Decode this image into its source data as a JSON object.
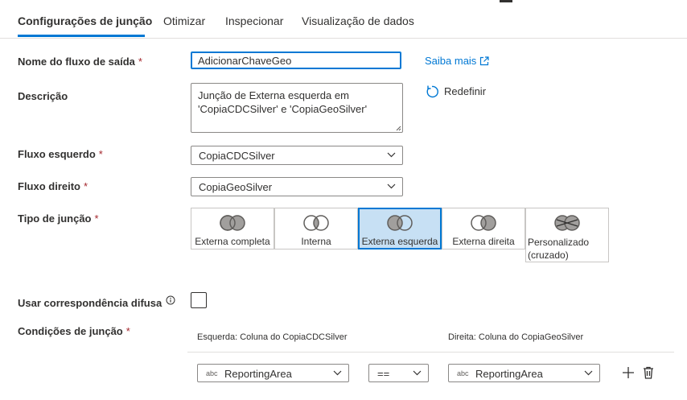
{
  "tabs": [
    {
      "label": "Configurações de junção",
      "active": true
    },
    {
      "label": "Otimizar",
      "active": false
    },
    {
      "label": "Inspecionar",
      "active": false
    },
    {
      "label": "Visualização de dados",
      "active": false
    }
  ],
  "form": {
    "output_stream": {
      "label": "Nome do fluxo de saída",
      "required": "*",
      "value": "AdicionarChaveGeo"
    },
    "description": {
      "label": "Descrição",
      "value": "Junção de Externa esquerda em 'CopiaCDCSilver' e 'CopiaGeoSilver'"
    },
    "left_stream": {
      "label": "Fluxo esquerdo",
      "required": "*",
      "value": "CopiaCDCSilver"
    },
    "right_stream": {
      "label": "Fluxo direito",
      "required": "*",
      "value": "CopiaGeoSilver"
    },
    "join_type": {
      "label": "Tipo de junção",
      "required": "*",
      "options": [
        {
          "label": "Externa completa",
          "icon": "venn-full-outer-icon",
          "selected": false
        },
        {
          "label": "Interna",
          "icon": "venn-inner-icon",
          "selected": false
        },
        {
          "label": "Externa esquerda",
          "icon": "venn-left-outer-icon",
          "selected": true
        },
        {
          "label": "Externa direita",
          "icon": "venn-right-outer-icon",
          "selected": false
        },
        {
          "label": "Personalizado (cruzado)",
          "icon": "venn-cross-icon",
          "selected": false
        }
      ]
    },
    "fuzzy": {
      "label": "Usar correspondência difusa",
      "checked": false
    },
    "conditions": {
      "label": "Condições de junção",
      "required": "*",
      "left_header": "Esquerda: Coluna do CopiaCDCSilver",
      "right_header": "Direita: Coluna do CopiaGeoSilver",
      "rows": [
        {
          "type_badge": "abc",
          "left": "ReportingArea",
          "operator": "==",
          "right_type_badge": "abc",
          "right": "ReportingArea"
        }
      ]
    }
  },
  "links": {
    "learn_more": "Saiba mais",
    "reset": "Redefinir"
  },
  "colors": {
    "accent": "#0078d4",
    "selected_bg": "#c7e0f4",
    "required": "#a4262c"
  }
}
